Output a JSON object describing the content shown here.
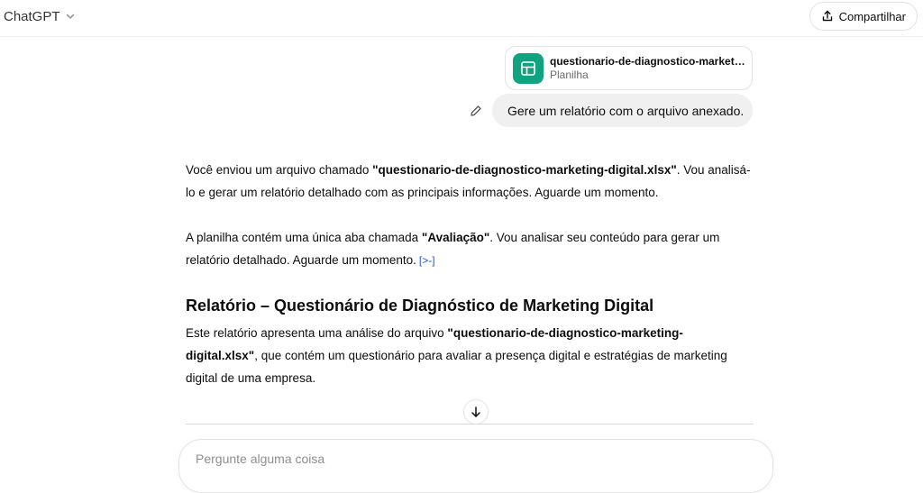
{
  "header": {
    "model_label": "ChatGPT",
    "share_label": "Compartilhar"
  },
  "attachment": {
    "file_name": "questionario-de-diagnostico-marketin...",
    "file_type": "Planilha"
  },
  "user_message": "Gere um relatório com o arquivo anexado.",
  "assistant": {
    "p1": {
      "a": "Você enviou um arquivo chamado ",
      "quoted": "\"questionario-de-diagnostico-marketing-digital.xlsx\"",
      "b": ". Vou analisá-lo e gerar um relatório detalhado com as principais informações. Aguarde um momento."
    },
    "p2": {
      "a": "A planilha contém uma única aba chamada ",
      "quoted": "\"Avaliação\"",
      "b": ". Vou analisar seu conteúdo para gerar um relatório detalhado. Aguarde um momento.",
      "source_chip": "[>-]"
    },
    "report_title": "Relatório – Questionário de Diagnóstico de Marketing Digital",
    "p3": {
      "a": "Este relatório apresenta uma análise do arquivo ",
      "quoted": "\"questionario-de-diagnostico-marketing-digital.xlsx\"",
      "b": ", que contém um questionário para avaliar a presença digital e estratégias de marketing digital de uma empresa."
    }
  },
  "composer": {
    "placeholder": "Pergunte alguma coisa"
  },
  "colors": {
    "file_icon_bg": "#10a37f",
    "user_bubble_bg": "#f0f0f0",
    "source_chip": "#1a5cd0"
  },
  "icons": {
    "model_chevron": "chevron-down-icon",
    "share": "share-icon",
    "file": "spreadsheet-icon",
    "edit": "pencil-icon",
    "scroll": "arrow-down-icon"
  }
}
